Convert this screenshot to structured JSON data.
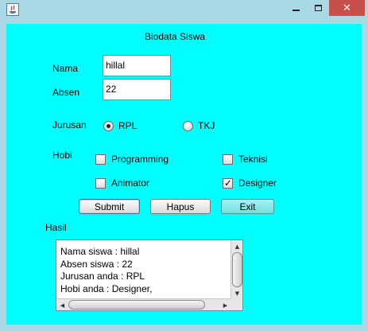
{
  "window": {
    "controls": {
      "minimize": "–",
      "maximize": "□",
      "close": "✕"
    },
    "icon": "java-app-icon"
  },
  "form": {
    "title": "Biodata Siswa",
    "nama_label": "Nama",
    "nama_value": "hillal",
    "absen_label": "Absen",
    "absen_value": "22",
    "jurusan_label": "Jurusan",
    "jurusan_options": [
      {
        "label": "RPL",
        "selected": true
      },
      {
        "label": "TKJ",
        "selected": false
      }
    ],
    "hobi_label": "Hobi",
    "hobi_options": [
      {
        "label": "Programming",
        "checked": false
      },
      {
        "label": "Teknisi",
        "checked": false
      },
      {
        "label": "Animator",
        "checked": false
      },
      {
        "label": "Designer",
        "checked": true
      }
    ],
    "buttons": {
      "submit": "Submit",
      "hapus": "Hapus",
      "exit": "Exit"
    },
    "hasil_label": "Hasil",
    "hasil_lines": [
      "Nama siswa : hillal",
      "Absen siswa : 22",
      "Jurusan anda : RPL",
      "Hobi anda : Designer,"
    ]
  },
  "colors": {
    "panel_background": "#00ffff",
    "close_button": "#c7504a"
  }
}
